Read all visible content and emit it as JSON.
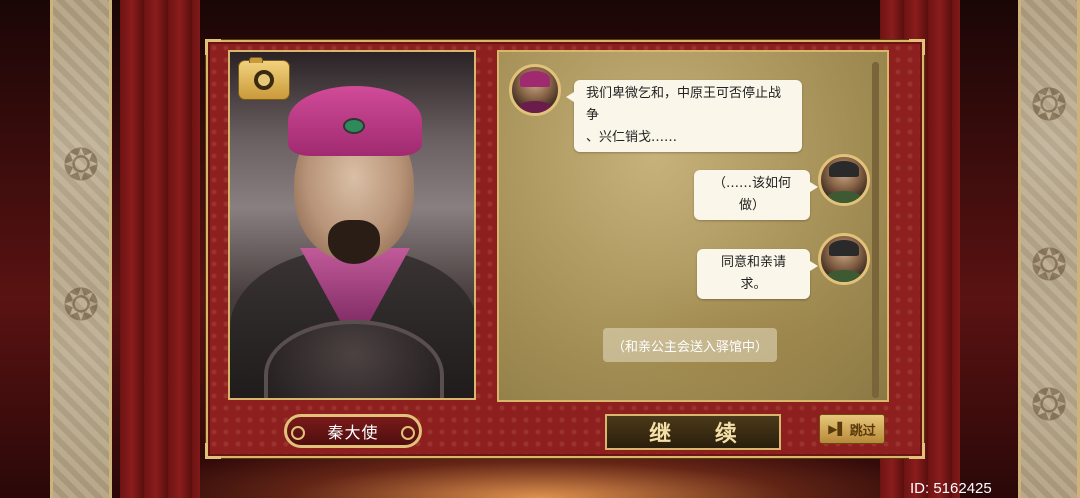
{
  "dialog": {
    "messages": [
      {
        "speaker": "envoy",
        "text": "我们卑微乞和，中原王可否停止战争"
      },
      {
        "speaker": "envoy",
        "text": "、兴仁销戈……"
      },
      {
        "speaker": "player",
        "text": "（……该如何做）"
      },
      {
        "speaker": "player",
        "text": "同意和亲请求。"
      }
    ],
    "narration": "（和亲公主会送入驿馆中）"
  },
  "character": {
    "name": "秦大使"
  },
  "buttons": {
    "continue": "继 续",
    "skip": "跳过"
  },
  "footer": {
    "id_text": "ID: 5162425"
  },
  "icons": {
    "camera": "camera-icon",
    "skip": "skip-forward-icon"
  },
  "colors": {
    "frame_red": "#8d1f1f",
    "gold": "#d8b66b"
  }
}
